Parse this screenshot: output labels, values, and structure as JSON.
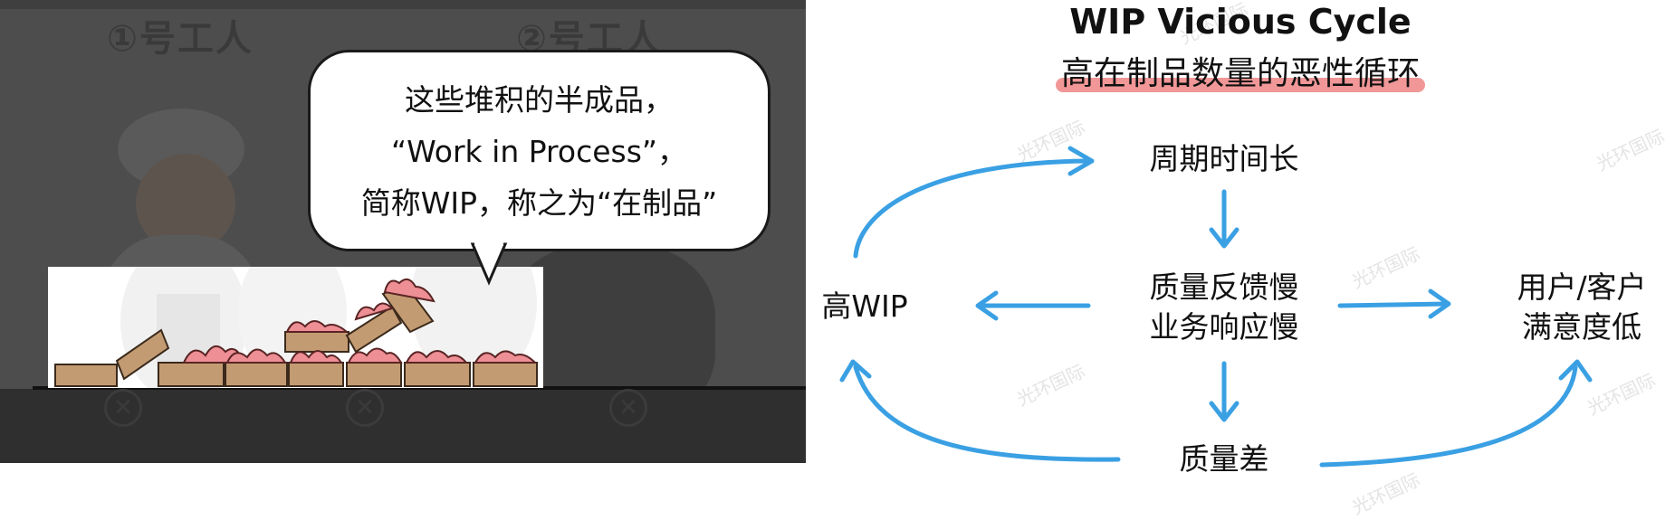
{
  "comic": {
    "worker_1": "①号工人",
    "worker_2": "②号工人",
    "speech": {
      "line1": "这些堆积的半成品，",
      "line2_open": "“",
      "line2_term": "Work in Process",
      "line2_close": "”，",
      "line3_pre": "简称",
      "line3_abbr": "WIP",
      "line3_mid": "，称之为“",
      "line3_term": "在制品",
      "line3_close": "”"
    }
  },
  "diagram": {
    "title_en": "WIP Vicious Cycle",
    "title_cn": "高在制品数量的恶性循环",
    "nodes": {
      "long_cycle": "周期时间长",
      "slow_feedback_1": "质量反馈慢",
      "slow_feedback_2": "业务响应慢",
      "high_wip": "高WIP",
      "low_quality": "质量差",
      "low_satisfaction_1": "用户/客户",
      "low_satisfaction_2": "满意度低"
    },
    "watermark": "光环国际",
    "colors": {
      "arrow": "#3aa0e3",
      "title_highlight": "#f19797",
      "speech_highlight": "#8fc3ee"
    }
  }
}
